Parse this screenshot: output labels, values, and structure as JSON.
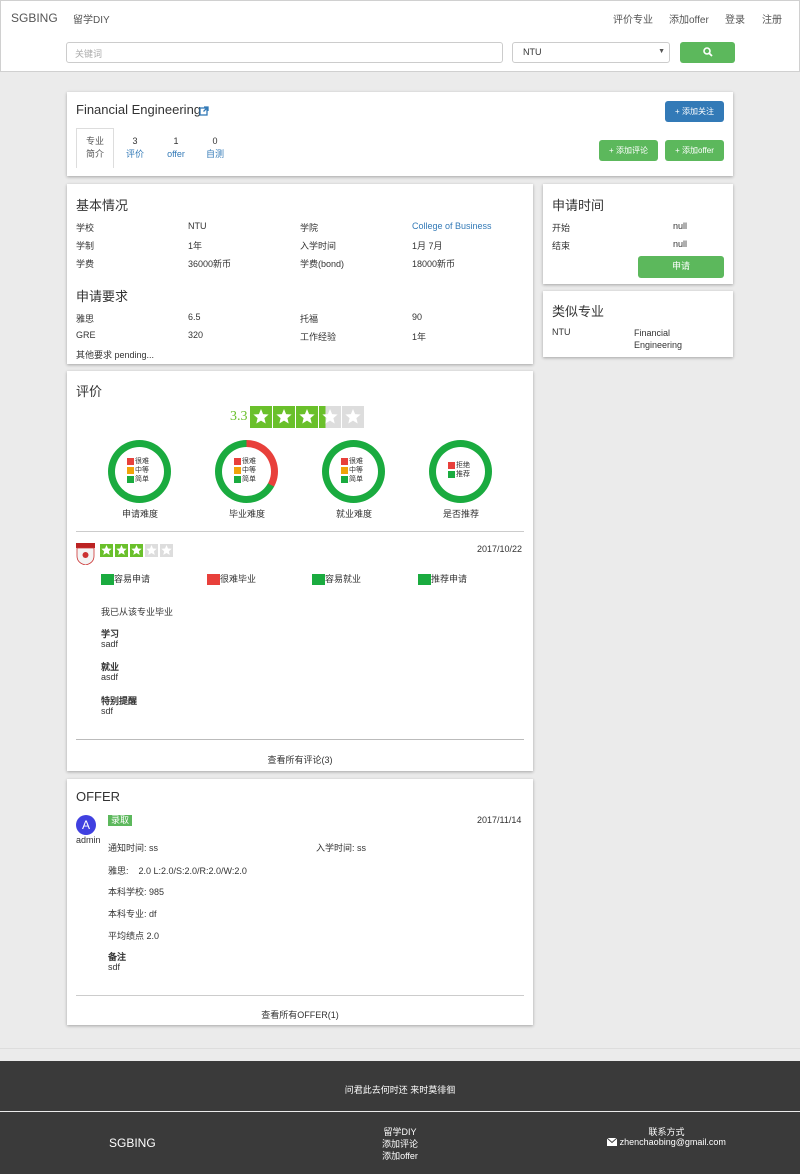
{
  "nav": {
    "brand": "SGBING",
    "diy": "留学DIY",
    "review_major": "评价专业",
    "add_offer": "添加offer",
    "login": "登录",
    "register": "注册"
  },
  "search": {
    "placeholder": "关键词",
    "university": "NTU"
  },
  "major": {
    "title": "Financial Engineering",
    "follow_btn": "+ 添加关注",
    "add_review_btn": "+ 添加评论",
    "add_offer_btn": "+ 添加offer",
    "tabs": [
      {
        "top": "专业",
        "bottom": "简介"
      },
      {
        "top": "3",
        "bottom": "评价"
      },
      {
        "top": "1",
        "bottom": "offer"
      },
      {
        "top": "0",
        "bottom": "自测"
      }
    ]
  },
  "basic": {
    "title": "基本情况",
    "rows": [
      [
        "学校",
        "NTU",
        "学院",
        "College of Business"
      ],
      [
        "学制",
        "1年",
        "入学时间",
        "1月 7月"
      ],
      [
        "学费",
        "36000新币",
        "学费(bond)",
        "18000新币"
      ]
    ]
  },
  "requirements": {
    "title": "申请要求",
    "rows": [
      [
        "雅思",
        "6.5",
        "托福",
        "90"
      ],
      [
        "GRE",
        "320",
        "工作经验",
        "1年"
      ]
    ],
    "other": "其他要求 pending..."
  },
  "apply_time": {
    "title": "申请时间",
    "start_label": "开始",
    "start_val": "null",
    "end_label": "结束",
    "end_val": "null",
    "apply_btn": "申请"
  },
  "similar": {
    "title": "类似专业",
    "school": "NTU",
    "major": "Financial Engineering"
  },
  "rating": {
    "title": "评价",
    "score": "3.3",
    "stars": 3.3,
    "donuts": [
      {
        "label": "申请难度",
        "legend": [
          "很难",
          "中等",
          "简单"
        ],
        "hard": 0
      },
      {
        "label": "毕业难度",
        "legend": [
          "很难",
          "中等",
          "简单"
        ],
        "hard": 0.33
      },
      {
        "label": "就业难度",
        "legend": [
          "很难",
          "中等",
          "简单"
        ],
        "hard": 0
      },
      {
        "label": "是否推荐",
        "legend": [
          "拒绝",
          "推荐"
        ],
        "hard": 0
      }
    ]
  },
  "review": {
    "stars": 3,
    "date": "2017/10/22",
    "tags": [
      {
        "text": "容易申请",
        "color": "#1aab3f"
      },
      {
        "text": "很难毕业",
        "color": "#e8403b"
      },
      {
        "text": "容易就业",
        "color": "#1aab3f"
      },
      {
        "text": "推荐申请",
        "color": "#1aab3f"
      }
    ],
    "graduated": "我已从该专业毕业",
    "study_label": "学习",
    "study": "sadf",
    "job_label": "就业",
    "job": "asdf",
    "note_label": "特别提醒",
    "note": "sdf",
    "view_all": "查看所有评论(3)"
  },
  "offer": {
    "title": "OFFER",
    "avatar": "A",
    "user": "admin",
    "status": "录取",
    "date": "2017/11/14",
    "notice": "通知时间: ss",
    "enroll": "入学时间: ss",
    "ielts": "雅思:    2.0 L:2.0/S:2.0/R:2.0/W:2.0",
    "school": "本科学校: 985",
    "major": "本科专业: df",
    "gpa": "平均绩点 2.0",
    "remark_label": "备注",
    "remark": "sdf",
    "view_all": "查看所有OFFER(1)"
  },
  "footer": {
    "slogan": "问君此去何时还 来时莫徘徊",
    "brand": "SGBING",
    "links": [
      "留学DIY",
      "添加评论",
      "添加offer"
    ],
    "contact_title": "联系方式",
    "email": "zhenchaobing@gmail.com"
  },
  "colors": {
    "green": "#5cb85c",
    "blue": "#337ab7",
    "star": "#6ac02b",
    "hard": "#e8403b",
    "mid": "#f0a30a",
    "easy": "#1aab3f"
  }
}
